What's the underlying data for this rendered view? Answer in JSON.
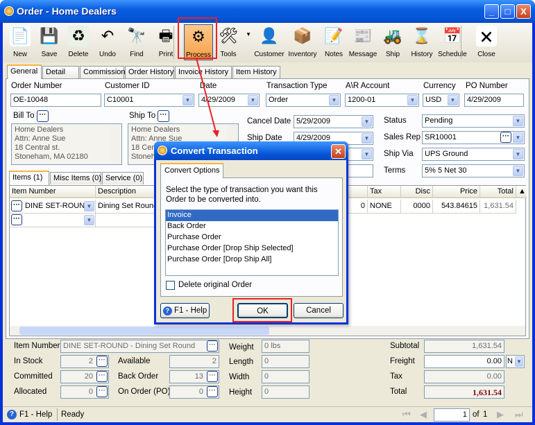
{
  "window": {
    "title": "Order - Home Dealers",
    "min": "_",
    "max": "□",
    "close": "X"
  },
  "toolbar": [
    {
      "label": "New",
      "icon": "new-document-icon"
    },
    {
      "label": "Save",
      "icon": "floppy-disk-icon"
    },
    {
      "label": "Delete",
      "icon": "recycle-bin-icon"
    },
    {
      "label": "Undo",
      "icon": "undo-arrow-icon"
    },
    {
      "label": "Find",
      "icon": "binoculars-icon"
    },
    {
      "label": "Print",
      "icon": "printer-icon"
    },
    {
      "label": "Process",
      "icon": "process-gear-icon",
      "selected": true
    },
    {
      "label": "Tools",
      "icon": "tools-icon",
      "dropdown": true
    },
    {
      "label": "Customer",
      "icon": "customer-icon"
    },
    {
      "label": "Inventory",
      "icon": "boxes-icon"
    },
    {
      "label": "Notes",
      "icon": "notepad-icon"
    },
    {
      "label": "Message",
      "icon": "message-icon"
    },
    {
      "label": "Ship",
      "icon": "forklift-icon"
    },
    {
      "label": "History",
      "icon": "history-hourglass-icon"
    },
    {
      "label": "Schedule",
      "icon": "schedule-icon"
    },
    {
      "label": "Close",
      "icon": "close-window-icon"
    }
  ],
  "tabs": [
    "General",
    "Detail",
    "Commission",
    "Order History",
    "Invoice History",
    "Item History"
  ],
  "header": {
    "order_number_label": "Order Number",
    "order_number": "OE-10048",
    "customer_id_label": "Customer ID",
    "customer_id": "C10001",
    "date_label": "Date",
    "date": "4/29/2009",
    "transaction_type_label": "Transaction Type",
    "transaction_type": "Order",
    "ar_account_label": "A\\R Account",
    "ar_account": "1200-01",
    "currency_label": "Currency",
    "currency": "USD",
    "po_number_label": "PO Number",
    "po_number": "4/29/2009",
    "bill_to_label": "Bill To",
    "bill_to": [
      "Home Dealers",
      "Attn: Anne Sue",
      "18 Central st.",
      "Stoneham, MA 02180"
    ],
    "ship_to_label": "Ship To",
    "ship_to": [
      "Home Dealers",
      "Attn: Anne Sue",
      "18 Central st.",
      "Stoneham, MA 02180"
    ],
    "cancel_date_label": "Cancel  Date",
    "cancel_date": "5/29/2009",
    "ship_date_label": "Ship Date",
    "ship_date": "4/29/2009",
    "status_label": "Status",
    "status": "Pending",
    "sales_rep_label": "Sales Rep",
    "sales_rep": "SR10001",
    "ship_via_label": "Ship Via",
    "ship_via": "UPS Ground",
    "terms_label": "Terms",
    "terms": "5% 5 Net 30"
  },
  "item_tabs": [
    "Items (1)",
    "Misc Items (0)",
    "Service (0)"
  ],
  "grid": {
    "columns": [
      "Item Number",
      "Description",
      "Allocate",
      "Tax",
      "Disc",
      "Price",
      "Total"
    ],
    "rows": [
      {
        "item": "DINE SET-ROUND",
        "description": "Dining Set Round",
        "allocate": "0",
        "tax": "NONE",
        "disc": "0000",
        "price": "543.84615",
        "total": "1,631.54"
      }
    ]
  },
  "footer": {
    "item_number_label": "Item Number",
    "item_number": "DINE SET-ROUND - Dining Set Round",
    "in_stock_label": "In Stock",
    "in_stock": "2",
    "available_label": "Available",
    "available": "2",
    "committed_label": "Committed",
    "committed": "20",
    "back_order_label": "Back Order",
    "back_order": "13",
    "allocated_label": "Allocated",
    "allocated": "0",
    "on_order_label": "On Order (PO)",
    "on_order": "0",
    "weight_label": "Weight",
    "weight": "0 lbs",
    "length_label": "Length",
    "length": "0",
    "width_label": "Width",
    "width": "0",
    "height_label": "Height",
    "height": "0",
    "subtotal_label": "Subtotal",
    "subtotal": "1,631.54",
    "freight_label": "Freight",
    "freight": "0.00",
    "freight_code": "N",
    "tax_label": "Tax",
    "tax": "0.00",
    "total_label": "Total",
    "total": "1,631.54"
  },
  "statusbar": {
    "help": "F1 - Help",
    "status": "Ready",
    "page": "1",
    "of_label": "of",
    "total_pages": "1"
  },
  "dialog": {
    "title": "Convert Transaction",
    "tab": "Convert  Options",
    "prompt": "Select the type of transaction you want this Order to be converted into.",
    "options": [
      "Invoice",
      "Back Order",
      "Purchase Order",
      "Purchase Order [Drop Ship Selected]",
      "Purchase Order [Drop Ship All]"
    ],
    "selected": "Invoice",
    "delete_original_label": "Delete original Order",
    "delete_original": false,
    "help": "F1 - Help",
    "ok": "OK",
    "cancel": "Cancel"
  },
  "colors": {
    "highlight": "#e8222a",
    "selection": "#316ac5",
    "total": "#7a0a0a",
    "title_bar": "#0453d5"
  }
}
